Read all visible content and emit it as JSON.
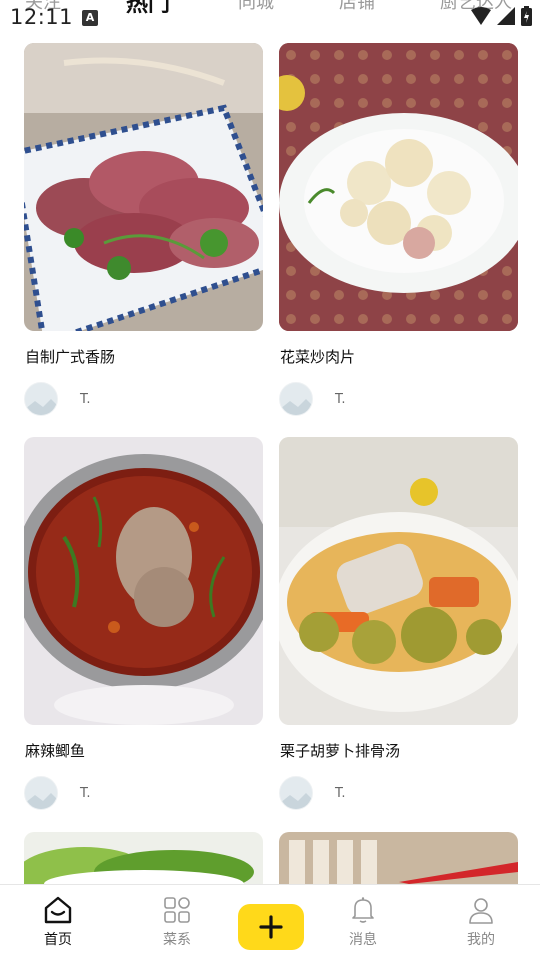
{
  "status_bar": {
    "time": "12:11",
    "a_icon": "A"
  },
  "top_tabs": [
    "关注",
    "热门",
    "同城",
    "店铺",
    "厨艺达人"
  ],
  "feed": [
    {
      "title": "自制广式香肠",
      "author": "T."
    },
    {
      "title": "花菜炒肉片",
      "author": "T."
    },
    {
      "title": "麻辣鲫鱼",
      "author": "T."
    },
    {
      "title": "栗子胡萝卜排骨汤",
      "author": "T."
    }
  ],
  "bottom_nav": {
    "home": "首页",
    "cuisine": "菜系",
    "messages": "消息",
    "me": "我的"
  },
  "colors": {
    "accent": "#ffd91a",
    "active_text": "#111111",
    "inactive_text": "#888888"
  }
}
